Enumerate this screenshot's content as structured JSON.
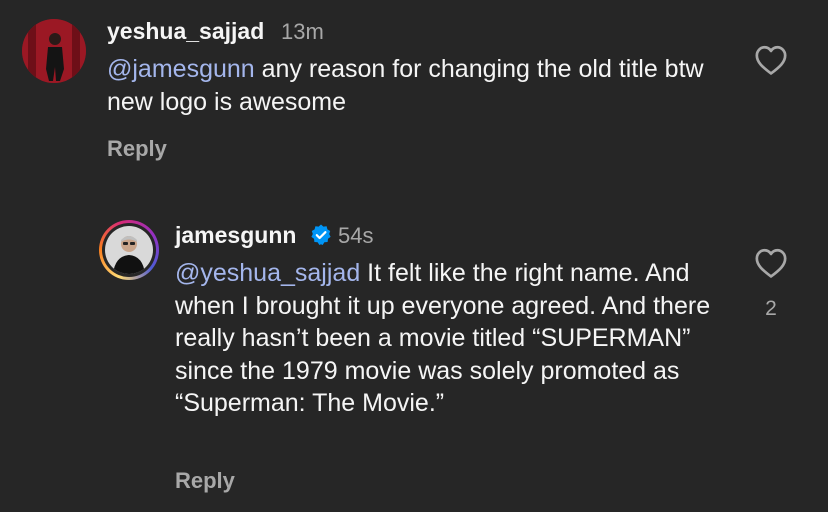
{
  "comments": [
    {
      "username": "yeshua_sajjad",
      "time": "13m",
      "mention": "@jamesgunn",
      "text": " any reason for changing the old title btw new logo is awesome",
      "reply_label": "Reply",
      "like_count": ""
    },
    {
      "username": "jamesgunn",
      "time": "54s",
      "verified": true,
      "mention": "@yeshua_sajjad",
      "text": " It felt like the right name. And when I brought it up everyone agreed. And there really hasn’t been a movie titled “SUPERMAN” since the 1979 movie was solely promoted as “Superman: The Movie.”",
      "reply_label": "Reply",
      "like_count": "2"
    }
  ],
  "colors": {
    "background": "#262626",
    "text": "#f5f5f5",
    "secondary_text": "#a8a8a8",
    "mention": "#a4b6ec",
    "verified_badge": "#0095f6"
  }
}
